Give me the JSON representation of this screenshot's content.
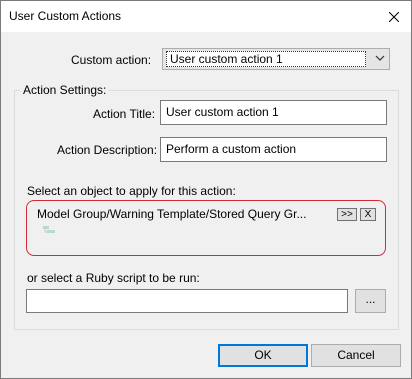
{
  "window": {
    "title": "User Custom Actions",
    "close_glyph": "✕"
  },
  "custom_action": {
    "label": "Custom action:",
    "value": "User custom action 1"
  },
  "action_settings": {
    "group_label": "Action Settings:",
    "title_label": "Action Title:",
    "title_value": "User custom action 1",
    "description_label": "Action Description:",
    "description_value": "Perform a custom action"
  },
  "object_select": {
    "label": "Select an object to apply for this action:",
    "path": "Model Group/Warning Template/Stored Query Gr...",
    "expand_label": ">>",
    "clear_label": "X",
    "icon": "tree-node-icon"
  },
  "ruby": {
    "label": "or select a Ruby script to be run:",
    "value": "",
    "browse_label": "..."
  },
  "buttons": {
    "ok": "OK",
    "cancel": "Cancel"
  },
  "colors": {
    "highlight_border": "#d42a3a",
    "default_button_border": "#0078d7"
  }
}
